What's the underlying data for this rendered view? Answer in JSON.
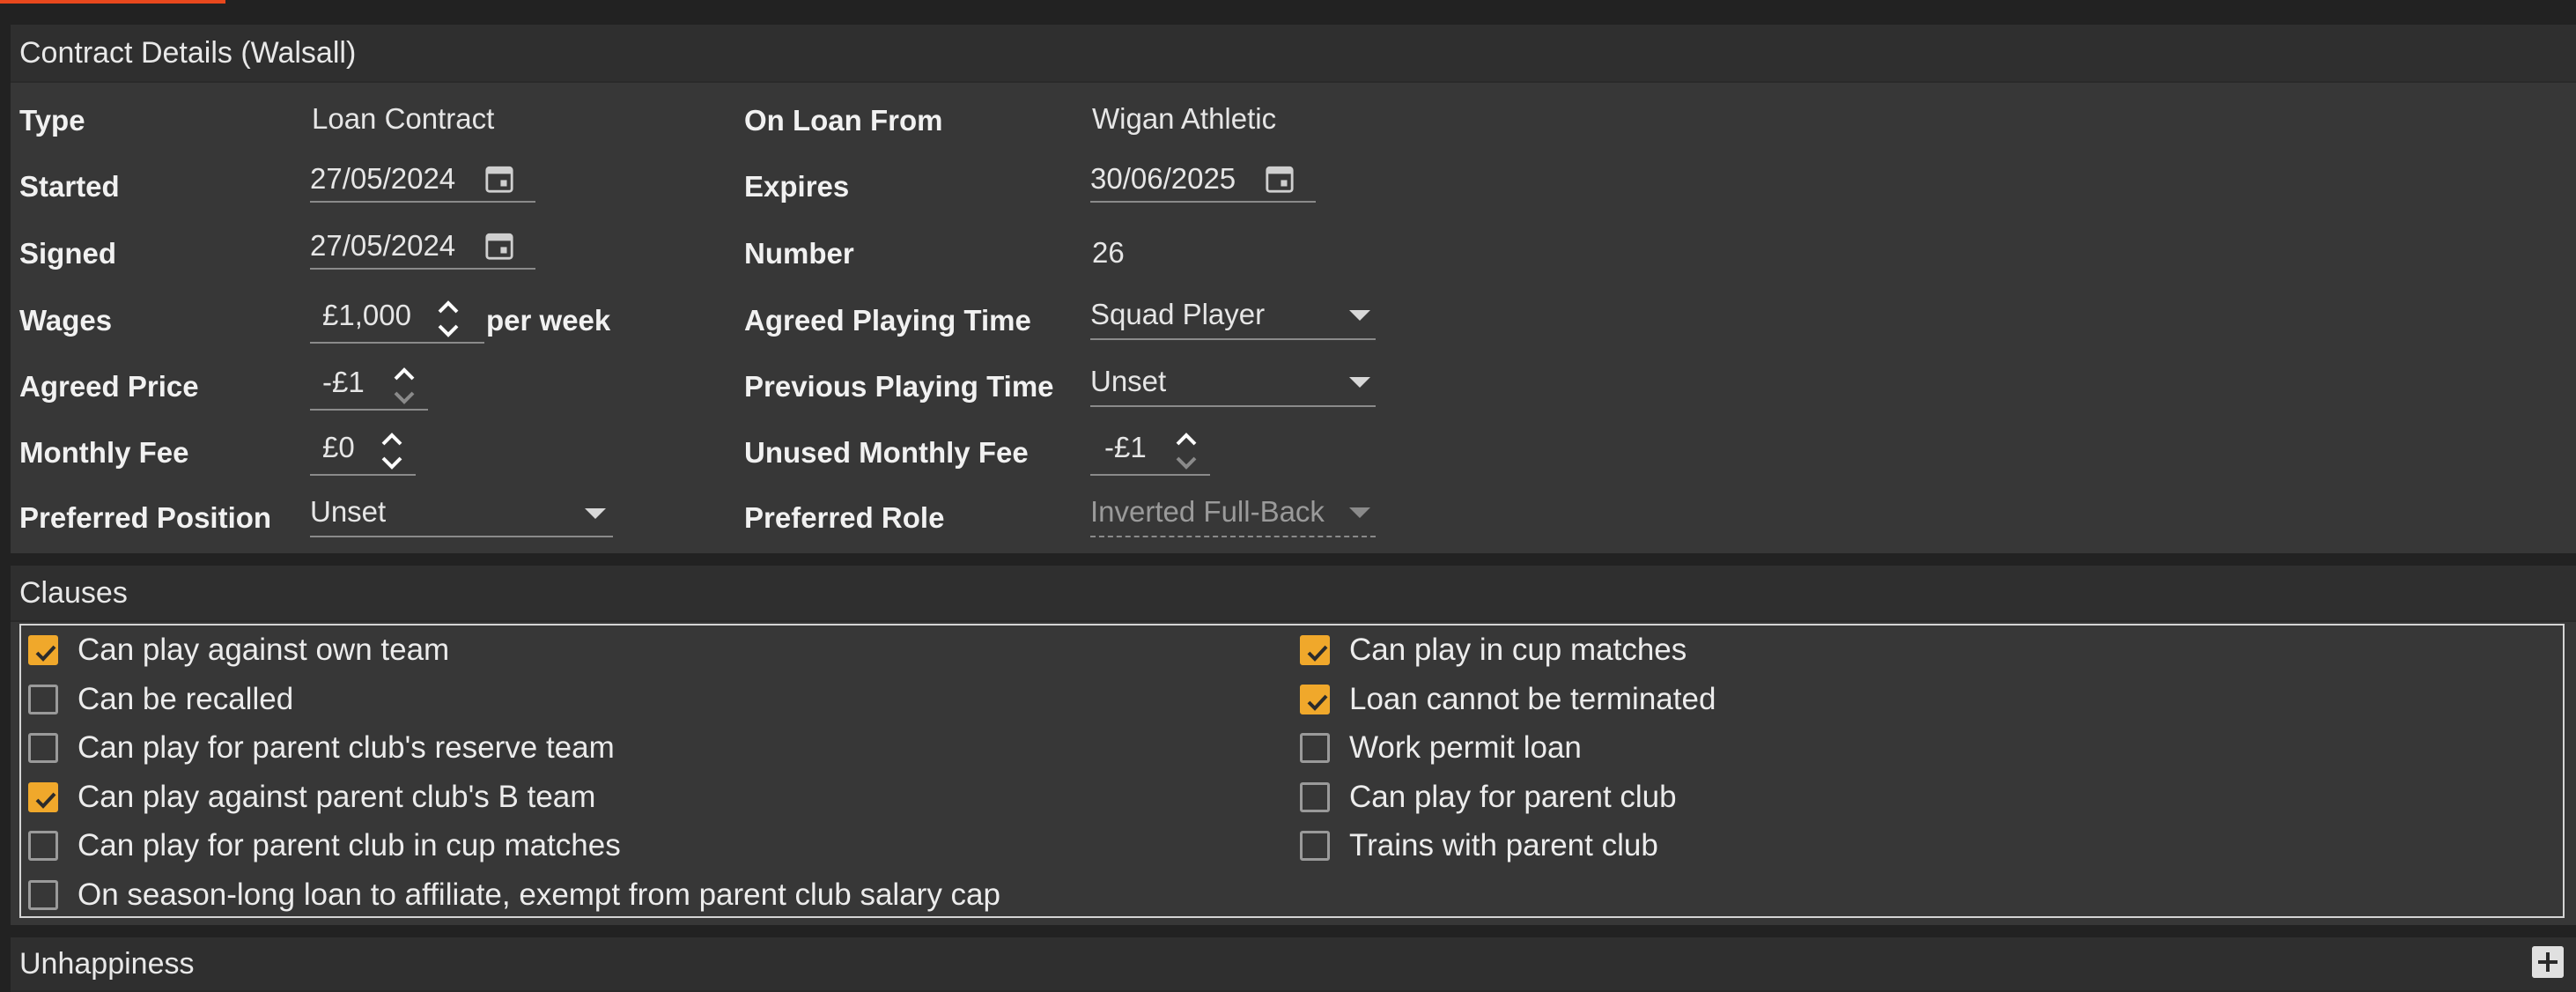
{
  "contract": {
    "title": "Contract Details (Walsall)",
    "left": {
      "type_label": "Type",
      "type_value": "Loan Contract",
      "started_label": "Started",
      "started_value": "27/05/2024",
      "signed_label": "Signed",
      "signed_value": "27/05/2024",
      "wages_label": "Wages",
      "wages_value": "£1,000",
      "wages_suffix": "per week",
      "agreed_price_label": "Agreed Price",
      "agreed_price_value": "-£1",
      "monthly_fee_label": "Monthly Fee",
      "monthly_fee_value": "£0",
      "preferred_position_label": "Preferred Position",
      "preferred_position_value": "Unset"
    },
    "right": {
      "on_loan_from_label": "On Loan From",
      "on_loan_from_value": "Wigan Athletic",
      "expires_label": "Expires",
      "expires_value": "30/06/2025",
      "number_label": "Number",
      "number_value": "26",
      "agreed_playing_time_label": "Agreed Playing Time",
      "agreed_playing_time_value": "Squad Player",
      "previous_playing_time_label": "Previous Playing Time",
      "previous_playing_time_value": "Unset",
      "unused_monthly_fee_label": "Unused Monthly Fee",
      "unused_monthly_fee_value": "-£1",
      "preferred_role_label": "Preferred Role",
      "preferred_role_value": "Inverted Full-Back"
    }
  },
  "clauses": {
    "title": "Clauses",
    "left": [
      {
        "label": "Can play against own team",
        "checked": true
      },
      {
        "label": "Can be recalled",
        "checked": false
      },
      {
        "label": "Can play for parent club's reserve team",
        "checked": false
      },
      {
        "label": "Can play against parent club's B team",
        "checked": true
      },
      {
        "label": "Can play for parent club in cup matches",
        "checked": false
      },
      {
        "label": "On season-long loan to affiliate, exempt from parent club salary cap",
        "checked": false
      }
    ],
    "right": [
      {
        "label": "Can play in cup matches",
        "checked": true
      },
      {
        "label": "Loan cannot be terminated",
        "checked": true
      },
      {
        "label": "Work permit loan",
        "checked": false
      },
      {
        "label": "Can play for parent club",
        "checked": false
      },
      {
        "label": "Trains with parent club",
        "checked": false
      }
    ]
  },
  "unhappiness": {
    "title": "Unhappiness"
  },
  "colors": {
    "accent": "#e8481d",
    "checkbox": "#f0a82b",
    "panel": "#373737",
    "background": "#222222"
  }
}
